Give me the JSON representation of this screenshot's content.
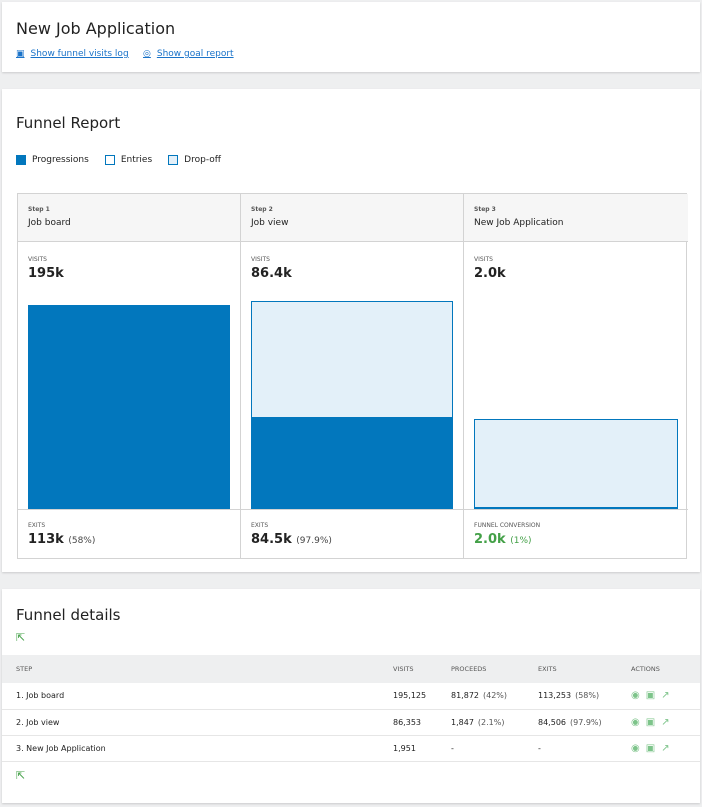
{
  "header": {
    "title": "New Job Application",
    "links": [
      {
        "label": "Show funnel visits log",
        "icon": "visits-log-icon"
      },
      {
        "label": "Show goal report",
        "icon": "goal-icon"
      }
    ]
  },
  "report": {
    "title": "Funnel Report",
    "legend": [
      "Progressions",
      "Entries",
      "Drop-off"
    ],
    "steps": [
      {
        "step": "Step 1",
        "name": "Job board",
        "visits_label": "VISITS",
        "visits": "195k",
        "foot_label": "EXITS",
        "foot_value": "113k",
        "foot_pct": "(58%)"
      },
      {
        "step": "Step 2",
        "name": "Job view",
        "visits_label": "VISITS",
        "visits": "86.4k",
        "foot_label": "EXITS",
        "foot_value": "84.5k",
        "foot_pct": "(97.9%)"
      },
      {
        "step": "Step 3",
        "name": "New Job Application",
        "visits_label": "VISITS",
        "visits": "2.0k",
        "foot_label": "FUNNEL CONVERSION",
        "foot_value": "2.0k",
        "foot_pct": "(1%)"
      }
    ],
    "colors": {
      "progression": "#0277bd",
      "dropoff": "#e3f0f9",
      "conversion": "#43a047"
    }
  },
  "details": {
    "title": "Funnel details",
    "columns": [
      "STEP",
      "VISITS",
      "PROCEEDS",
      "EXITS",
      "ACTIONS"
    ],
    "rows": [
      {
        "step": "1.  Job board",
        "visits": "195,125",
        "proceeds": "81,872",
        "proceeds_pct": "(42%)",
        "exits": "113,253",
        "exits_pct": "(58%)"
      },
      {
        "step": "2.  Job view",
        "visits": "86,353",
        "proceeds": "1,847",
        "proceeds_pct": "(2.1%)",
        "exits": "84,506",
        "exits_pct": "(97.9%)"
      },
      {
        "step": "3.  New Job Application",
        "visits": "1,951",
        "proceeds": "-",
        "proceeds_pct": "",
        "exits": "-",
        "exits_pct": ""
      }
    ]
  }
}
